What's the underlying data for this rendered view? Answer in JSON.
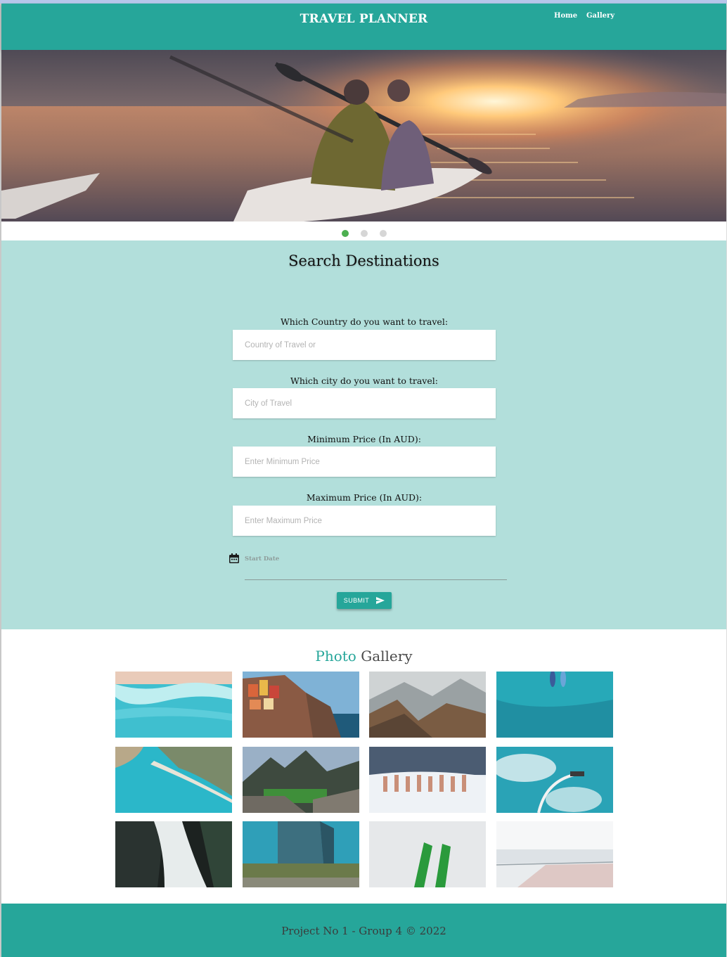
{
  "header": {
    "brand": "TRAVEL PLANNER",
    "nav": [
      "Home",
      "Gallery"
    ]
  },
  "carousel": {
    "slide_count": 3,
    "active_index": 0
  },
  "search": {
    "title": "Search Destinations",
    "fields": [
      {
        "label": "Which Country do you want to travel:",
        "placeholder": "Country of Travel or"
      },
      {
        "label": "Which city do you want to travel:",
        "placeholder": "City of Travel"
      },
      {
        "label": "Minimum Price (In AUD):",
        "placeholder": "Enter Minimum Price"
      },
      {
        "label": "Maximum Price (In AUD):",
        "placeholder": "Enter Maximum Price"
      }
    ],
    "start_date_label": "Start Date",
    "submit_label": "SUBMIT"
  },
  "gallery": {
    "title_accent": "Photo",
    "title_rest": "Gallery"
  },
  "footer": {
    "text": "Project No 1 - Group 4 © 2022"
  },
  "colors": {
    "primary": "#26a69a",
    "light_section": "#b2dfdb",
    "active_dot": "#4caf50"
  }
}
